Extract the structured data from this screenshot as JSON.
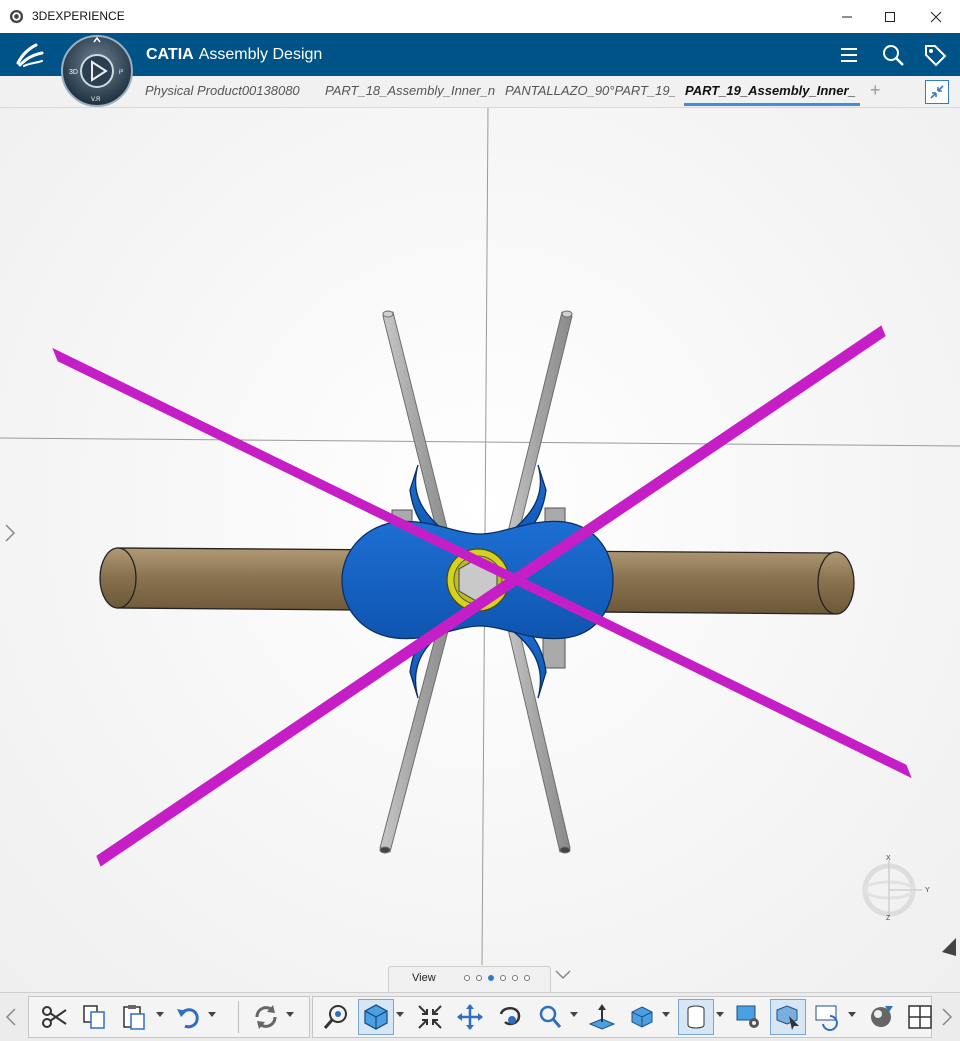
{
  "window": {
    "title": "3DEXPERIENCE"
  },
  "app": {
    "brand": "CATIA",
    "name": "Assembly Design",
    "compass_labels": {
      "left": "3D",
      "right": "i³",
      "bottom": "V.R"
    }
  },
  "tabs": [
    {
      "label": "Physical Product00138080",
      "active": false
    },
    {
      "label": "PART_18_Assembly_Inner_n",
      "active": false
    },
    {
      "label": "PANTALLAZO_90°PART_19_",
      "active": false
    },
    {
      "label": "PART_19_Assembly_Inner_",
      "active": true
    }
  ],
  "tab_add": "+",
  "view_tab": {
    "label": "View",
    "dots": 6,
    "active_dot": 2
  },
  "compass3d": {
    "x": "X",
    "y": "Y",
    "z": "Z"
  },
  "colors": {
    "appbar": "#005386",
    "accent": "#3d8fd8",
    "rod_magenta": "#c61ec6",
    "rod_gray": "#a8a8a8",
    "cylinder_tan": "#8b7350",
    "hub_blue": "#1463c4",
    "ring_yellow": "#d4cf1c"
  },
  "icons": {
    "header": [
      "menu-icon",
      "search-icon",
      "tag-icon"
    ],
    "toolbar": [
      "cut-icon",
      "copy-icon",
      "paste-icon",
      "undo-icon",
      "update-icon",
      "fly-mode-icon",
      "cube-view-icon",
      "fit-all-icon",
      "pan-icon",
      "rotate-icon",
      "zoom-icon",
      "normal-view-icon",
      "iso-view-icon",
      "cylinder-render-icon",
      "render-settings-icon",
      "select-icon",
      "refresh-view-icon",
      "material-icon",
      "layout-icon"
    ]
  }
}
